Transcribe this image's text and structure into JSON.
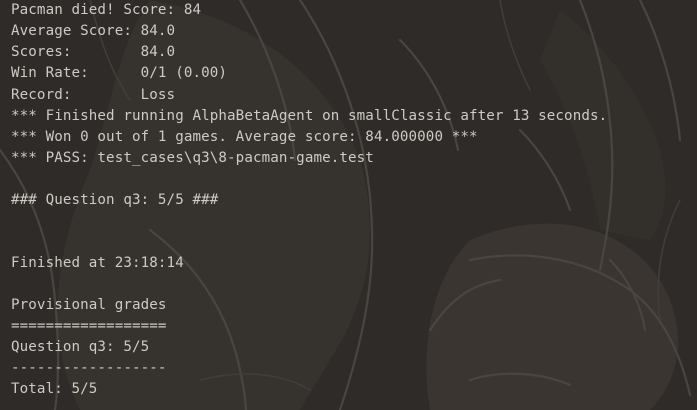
{
  "theme": {
    "background": "#2e2b28",
    "text_color": "#cfcac3"
  },
  "terminal": {
    "lines": [
      "Pacman died! Score: 84",
      "Average Score: 84.0",
      "Scores:        84.0",
      "Win Rate:      0/1 (0.00)",
      "Record:        Loss",
      "*** Finished running AlphaBetaAgent on smallClassic after 13 seconds.",
      "*** Won 0 out of 1 games. Average score: 84.000000 ***",
      "*** PASS: test_cases\\q3\\8-pacman-game.test",
      "",
      "### Question q3: 5/5 ###",
      "",
      "",
      "Finished at 23:18:14",
      "",
      "Provisional grades",
      "==================",
      "Question q3: 5/5",
      "------------------",
      "Total: 5/5"
    ]
  }
}
